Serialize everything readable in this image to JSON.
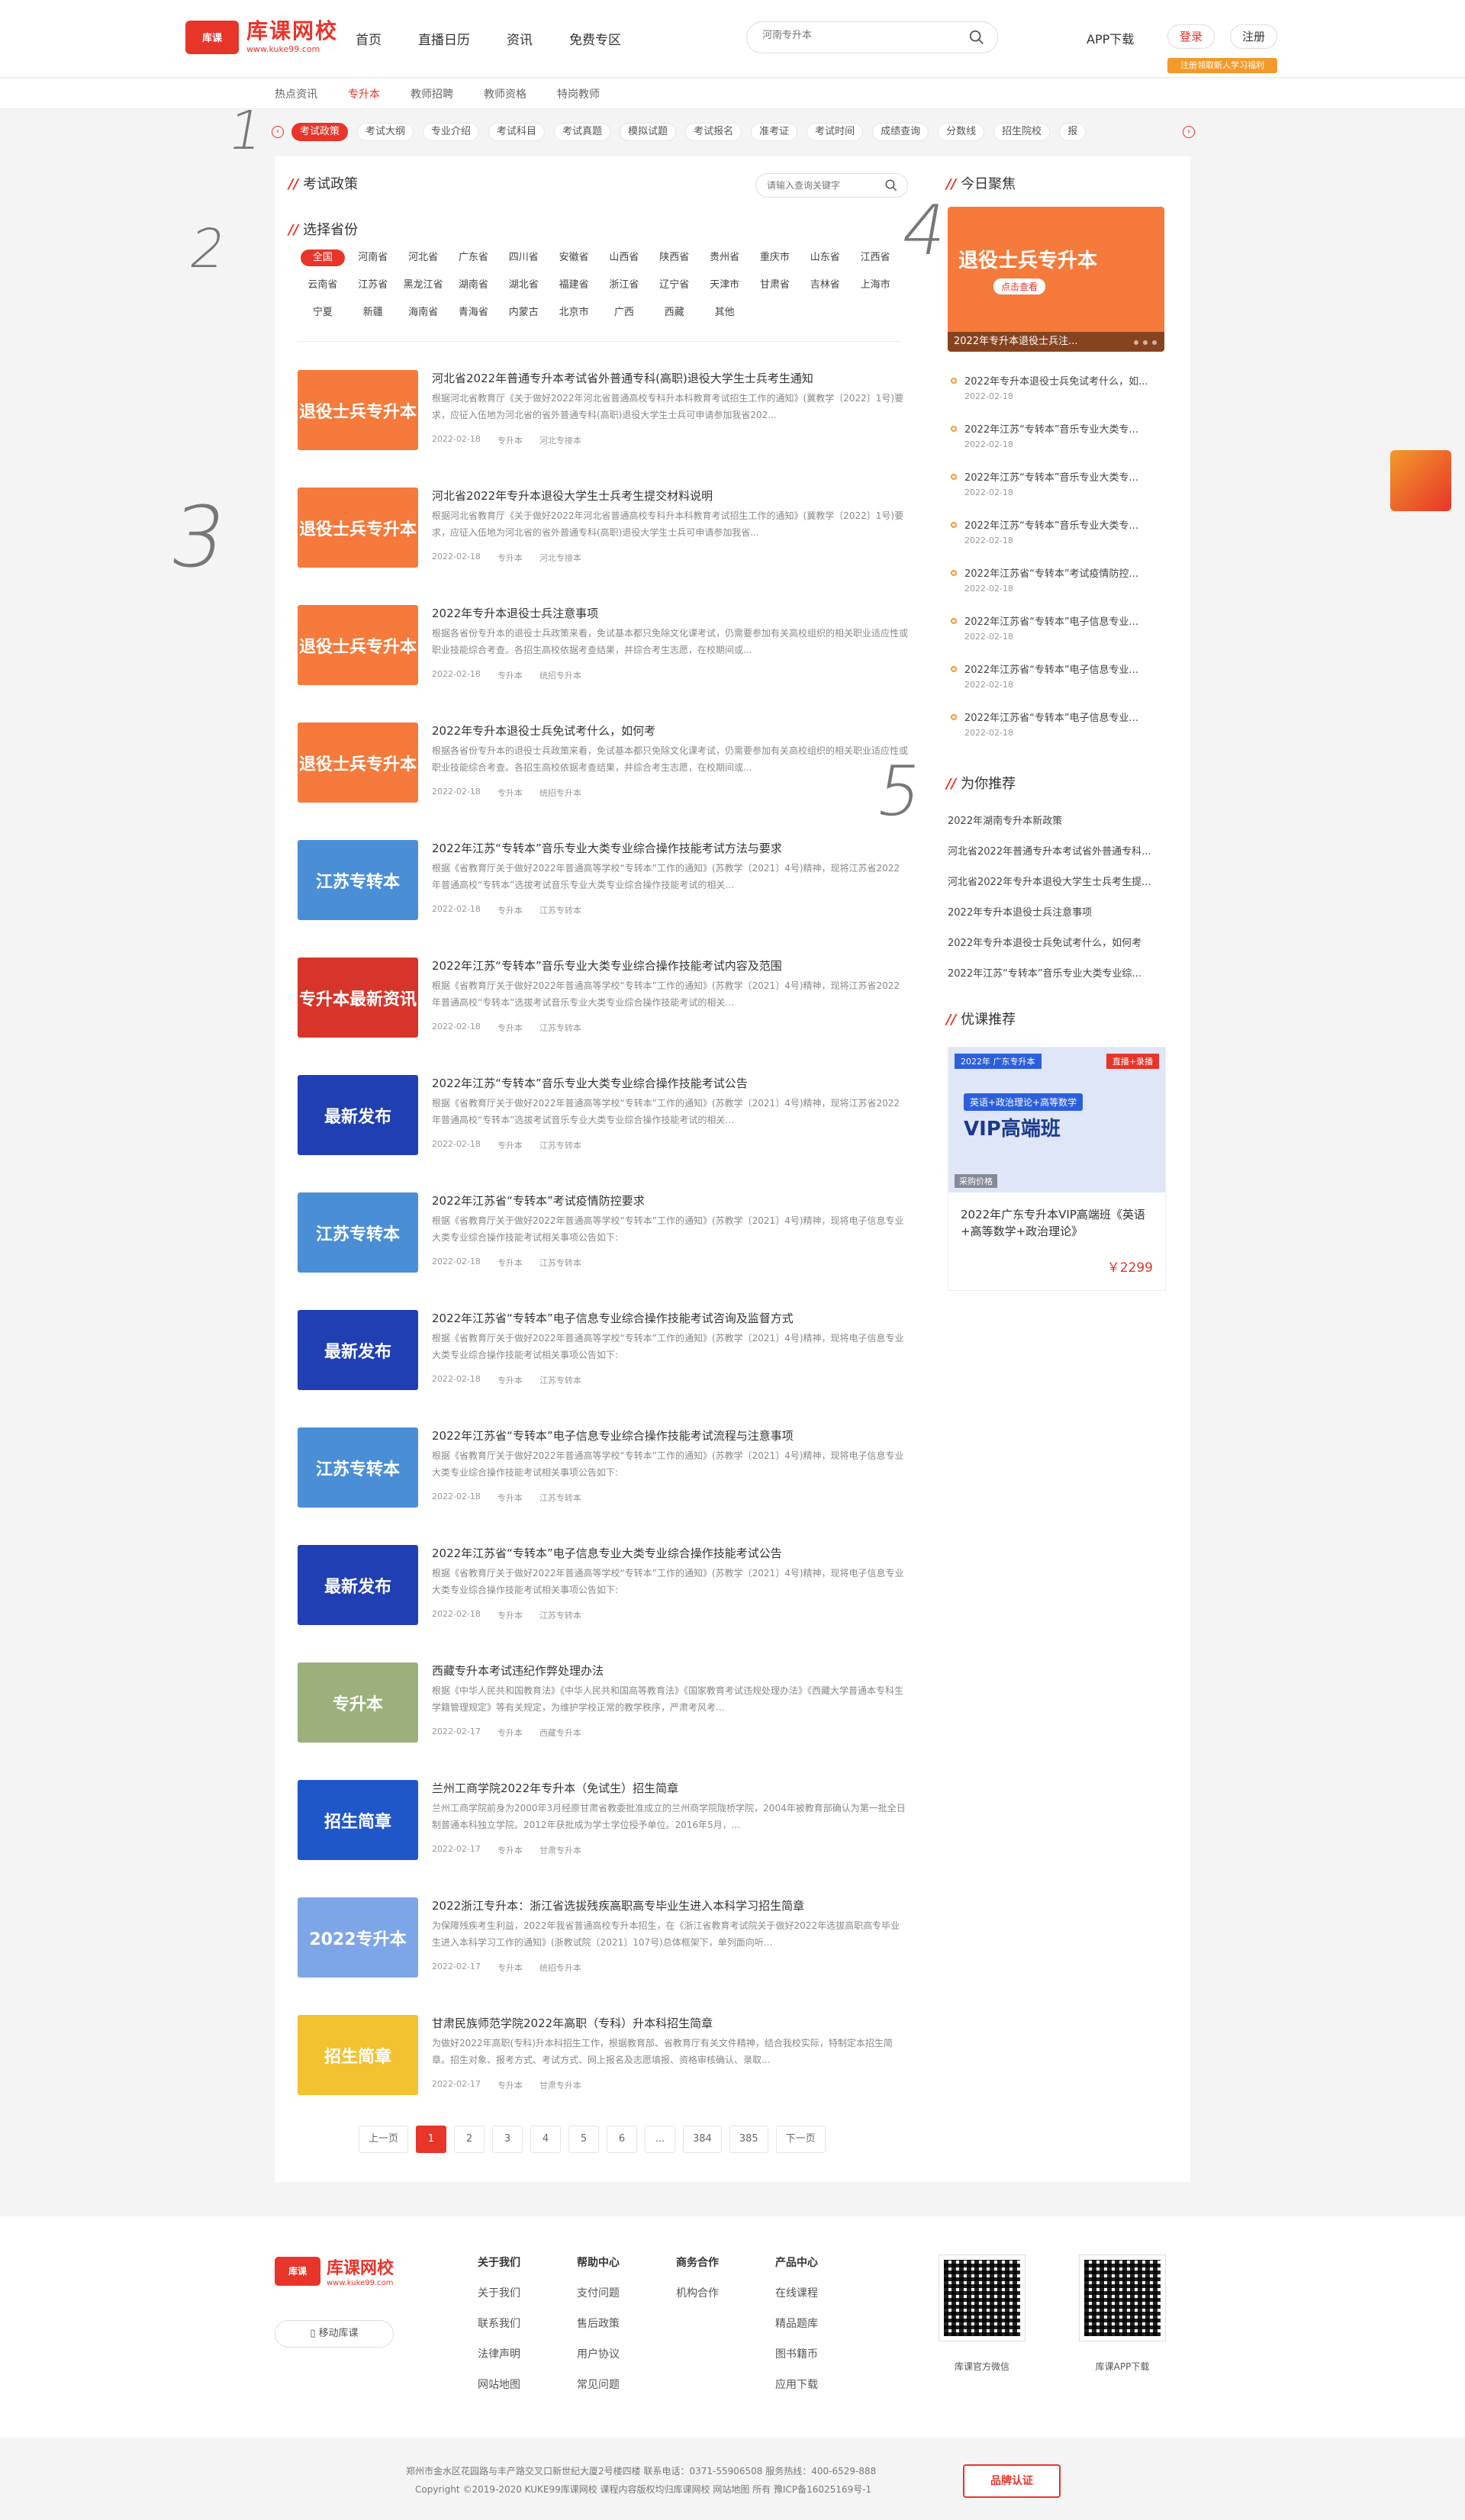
{
  "header": {
    "logo_badge": "库课",
    "logo_name": "库课网校",
    "logo_url": "www.kuke99.com",
    "nav": [
      "首页",
      "直播日历",
      "资讯",
      "免费专区"
    ],
    "search_placeholder": "河南专升本",
    "app_download": "APP下载",
    "login": "登录",
    "register": "注册",
    "promo": "注册领取新人学习福利"
  },
  "subnav": [
    "热点资讯",
    "专升本",
    "教师招聘",
    "教师资格",
    "特岗教师"
  ],
  "subnav_active": 1,
  "catbar": [
    "考试政策",
    "考试大纲",
    "专业介绍",
    "考试科目",
    "考试真题",
    "模拟试题",
    "考试报名",
    "准考证",
    "考试时间",
    "成绩查询",
    "分数线",
    "招生院校",
    "报"
  ],
  "catbar_active": 0,
  "policy": {
    "title": "考试政策",
    "search_placeholder": "请输入查询关键字"
  },
  "province": {
    "title": "选择省份",
    "items": [
      "全国",
      "河南省",
      "河北省",
      "广东省",
      "四川省",
      "安徽省",
      "山西省",
      "陕西省",
      "贵州省",
      "重庆市",
      "山东省",
      "江西省",
      "云南省",
      "江苏省",
      "黑龙江省",
      "湖南省",
      "湖北省",
      "福建省",
      "浙江省",
      "辽宁省",
      "天津市",
      "甘肃省",
      "吉林省",
      "上海市",
      "宁夏",
      "新疆",
      "海南省",
      "青海省",
      "内蒙古",
      "北京市",
      "广西",
      "西藏",
      "其他"
    ]
  },
  "articles": [
    {
      "title": "河北省2022年普通专升本考试省外普通专科(高职)退役大学生士兵考生通知",
      "desc": "根据河北省教育厅《关于做好2022年河北省普通高校专科升本科教育考试招生工作的通知》(冀教学〔2022〕1号)要求，应征入伍地为河北省的省外普通专科(高职)退役大学生士兵可申请参加我省202...",
      "date": "2022-02-18",
      "cat": "专升本",
      "region": "河北专接本",
      "thumb": "退役士兵专升本",
      "color": "#f57a3b"
    },
    {
      "title": "河北省2022年专升本退役大学生士兵考生提交材料说明",
      "desc": "根据河北省教育厅《关于做好2022年河北省普通高校专科升本科教育考试招生工作的通知》(冀教学〔2022〕1号)要求，应征入伍地为河北省的省外普通专科(高职)退役大学生士兵可申请参加我省...",
      "date": "2022-02-18",
      "cat": "专升本",
      "region": "河北专接本",
      "thumb": "退役士兵专升本",
      "color": "#f57a3b"
    },
    {
      "title": "2022年专升本退役士兵注意事项",
      "desc": "根据各省份专升本的退役士兵政策来看，免试基本都只免除文化课考试，仍需要参加有关高校组织的相关职业适应性或职业技能综合考查。各招生高校依据考查结果，并综合考生志愿，在校期间或...",
      "date": "2022-02-18",
      "cat": "专升本",
      "region": "统招专升本",
      "thumb": "退役士兵专升本",
      "color": "#f57a3b"
    },
    {
      "title": "2022年专升本退役士兵免试考什么，如何考",
      "desc": "根据各省份专升本的退役士兵政策来看，免试基本都只免除文化课考试，仍需要参加有关高校组织的相关职业适应性或职业技能综合考查。各招生高校依据考查结果，并综合考生志愿，在校期间或...",
      "date": "2022-02-18",
      "cat": "专升本",
      "region": "统招专升本",
      "thumb": "退役士兵专升本",
      "color": "#f57a3b"
    },
    {
      "title": "2022年江苏“专转本”音乐专业大类专业综合操作技能考试方法与要求",
      "desc": "根据《省教育厅关于做好2022年普通高等学校“专转本”工作的通知》(苏教学〔2021〕4号)精神，现将江苏省2022年普通高校“专转本”选拔考试音乐专业大类专业综合操作技能考试的相关...",
      "date": "2022-02-18",
      "cat": "专升本",
      "region": "江苏专转本",
      "thumb": "江苏专转本",
      "color": "#4a8fd6"
    },
    {
      "title": "2022年江苏“专转本”音乐专业大类专业综合操作技能考试内容及范围",
      "desc": "根据《省教育厅关于做好2022年普通高等学校“专转本”工作的通知》(苏教学〔2021〕4号)精神，现将江苏省2022年普通高校“专转本”选拔考试音乐专业大类专业综合操作技能考试的相关...",
      "date": "2022-02-18",
      "cat": "专升本",
      "region": "江苏专转本",
      "thumb": "专升本最新资讯",
      "color": "#d7352b"
    },
    {
      "title": "2022年江苏“专转本”音乐专业大类专业综合操作技能考试公告",
      "desc": "根据《省教育厅关于做好2022年普通高等学校“专转本”工作的通知》(苏教学〔2021〕4号)精神，现将江苏省2022年普通高校“专转本”选拔考试音乐专业大类专业综合操作技能考试的相关...",
      "date": "2022-02-18",
      "cat": "专升本",
      "region": "江苏专转本",
      "thumb": "最新发布",
      "color": "#1f3fb3"
    },
    {
      "title": "2022年江苏省“专转本”考试疫情防控要求",
      "desc": "根据《省教育厅关于做好2022年普通高等学校“专转本”工作的通知》(苏教学〔2021〕4号)精神，现将电子信息专业大类专业综合操作技能考试相关事项公告如下:",
      "date": "2022-02-18",
      "cat": "专升本",
      "region": "江苏专转本",
      "thumb": "江苏专转本",
      "color": "#4a8fd6"
    },
    {
      "title": "2022年江苏省“专转本”电子信息专业综合操作技能考试咨询及监督方式",
      "desc": "根据《省教育厅关于做好2022年普通高等学校“专转本”工作的通知》(苏教学〔2021〕4号)精神，现将电子信息专业大类专业综合操作技能考试相关事项公告如下:",
      "date": "2022-02-18",
      "cat": "专升本",
      "region": "江苏专转本",
      "thumb": "最新发布",
      "color": "#1f3fb3"
    },
    {
      "title": "2022年江苏省“专转本”电子信息专业综合操作技能考试流程与注意事项",
      "desc": "根据《省教育厅关于做好2022年普通高等学校“专转本”工作的通知》(苏教学〔2021〕4号)精神，现将电子信息专业大类专业综合操作技能考试相关事项公告如下:",
      "date": "2022-02-18",
      "cat": "专升本",
      "region": "江苏专转本",
      "thumb": "江苏专转本",
      "color": "#4a8fd6"
    },
    {
      "title": "2022年江苏省“专转本”电子信息专业大类专业综合操作技能考试公告",
      "desc": "根据《省教育厅关于做好2022年普通高等学校“专转本”工作的通知》(苏教学〔2021〕4号)精神，现将电子信息专业大类专业综合操作技能考试相关事项公告如下:",
      "date": "2022-02-18",
      "cat": "专升本",
      "region": "江苏专转本",
      "thumb": "最新发布",
      "color": "#1f3fb3"
    },
    {
      "title": "西藏专升本考试违纪作弊处理办法",
      "desc": "根据《中华人民共和国教育法》《中华人民共和国高等教育法》《国家教育考试违规处理办法》《西藏大学普通本专科生学籍管理规定》等有关规定，为维护学校正常的教学秩序，严肃考风考...",
      "date": "2022-02-17",
      "cat": "专升本",
      "region": "西藏专升本",
      "thumb": "专升本",
      "color": "#9bb07a"
    },
    {
      "title": "兰州工商学院2022年专升本（免试生）招生简章",
      "desc": "兰州工商学院前身为2000年3月经原甘肃省教委批准成立的兰州商学院陇桥学院，2004年被教育部确认为第一批全日制普通本科独立学院。2012年获批成为学士学位授予单位。2016年5月，...",
      "date": "2022-02-17",
      "cat": "专升本",
      "region": "甘肃专升本",
      "thumb": "招生简章",
      "color": "#1f57c8"
    },
    {
      "title": "2022浙江专升本：浙江省选拔残疾高职高专毕业生进入本科学习招生简章",
      "desc": "为保障残疾考生利益，2022年我省普通高校专升本招生，在《浙江省教育考试院关于做好2022年选拔高职高专毕业生进入本科学习工作的通知》(浙教试院〔2021〕107号)总体框架下，单列面向听...",
      "date": "2022-02-17",
      "cat": "专升本",
      "region": "统招专升本",
      "thumb": "2022专升本",
      "color": "#7da6e8"
    },
    {
      "title": "甘肃民族师范学院2022年高职（专科）升本科招生简章",
      "desc": "为做好2022年高职(专科)升本科招生工作，根据教育部、省教育厅有关文件精神，结合我校实际，特制定本招生简章。招生对象、报考方式、考试方式、网上报名及志愿填报、资格审核确认、录取...",
      "date": "2022-02-17",
      "cat": "专升本",
      "region": "甘肃专升本",
      "thumb": "招生简章",
      "color": "#f2c230"
    }
  ],
  "pager": [
    "上一页",
    "1",
    "2",
    "3",
    "4",
    "5",
    "6",
    "...",
    "384",
    "385",
    "下一页"
  ],
  "pager_active": 1,
  "today": {
    "title": "今日聚焦",
    "focus_title": "退役士兵专升本",
    "focus_sub": "点击查看",
    "focus_caption": "2022年专升本退役士兵注...",
    "items": [
      {
        "t": "2022年专升本退役士兵免试考什么，如...",
        "d": "2022-02-18"
      },
      {
        "t": "2022年江苏“专转本”音乐专业大类专...",
        "d": "2022-02-18"
      },
      {
        "t": "2022年江苏“专转本”音乐专业大类专...",
        "d": "2022-02-18"
      },
      {
        "t": "2022年江苏“专转本”音乐专业大类专...",
        "d": "2022-02-18"
      },
      {
        "t": "2022年江苏省“专转本”考试疫情防控...",
        "d": "2022-02-18"
      },
      {
        "t": "2022年江苏省“专转本”电子信息专业...",
        "d": "2022-02-18"
      },
      {
        "t": "2022年江苏省“专转本”电子信息专业...",
        "d": "2022-02-18"
      },
      {
        "t": "2022年江苏省“专转本”电子信息专业...",
        "d": "2022-02-18"
      }
    ]
  },
  "recommend": {
    "title": "为你推荐",
    "items": [
      "2022年湖南专升本新政策",
      "河北省2022年普通专升本考试省外普通专科...",
      "河北省2022年专升本退役大学生士兵考生提...",
      "2022年专升本退役士兵注意事项",
      "2022年专升本退役士兵免试考什么，如何考",
      "2022年江苏“专转本”音乐专业大类专业综..."
    ]
  },
  "course": {
    "title": "优课推荐",
    "tag": "2022年 广东专升本",
    "tag2": "直播+录播",
    "bar": "英语+政治理论+高等数学",
    "big": "VIP高端班",
    "avail": "采购价格",
    "name": "2022年广东专升本VIP高端班《英语+高等数学+政治理论》",
    "price": "￥2299"
  },
  "footer": {
    "logo_badge": "库课",
    "logo_name": "库课网校",
    "logo_url": "www.kuke99.com",
    "mobile": "移动库课",
    "cols": [
      {
        "h": "关于我们",
        "items": [
          "关于我们",
          "联系我们",
          "法律声明",
          "网站地图"
        ]
      },
      {
        "h": "帮助中心",
        "items": [
          "支付问题",
          "售后政策",
          "用户协议",
          "常见问题"
        ]
      },
      {
        "h": "商务合作",
        "items": [
          "机构合作"
        ]
      },
      {
        "h": "产品中心",
        "items": [
          "在线课程",
          "精品题库",
          "图书籍币",
          "应用下载"
        ]
      }
    ],
    "qr1": "库课官方微信",
    "qr2": "库课APP下载",
    "copy1": "郑州市金水区花园路与丰产路交叉口新世纪大厦2号楼四楼  联系电话：0371-55906508  服务热线：400-6529-888",
    "copy2": "Copyright ©2019-2020 KUKE99库课网校 课程内容版权均归库课网校 网站地图 所有 豫ICP备16025169号-1",
    "badge": "品牌认证"
  },
  "annotations": [
    "1",
    "2",
    "3",
    "4",
    "5"
  ]
}
